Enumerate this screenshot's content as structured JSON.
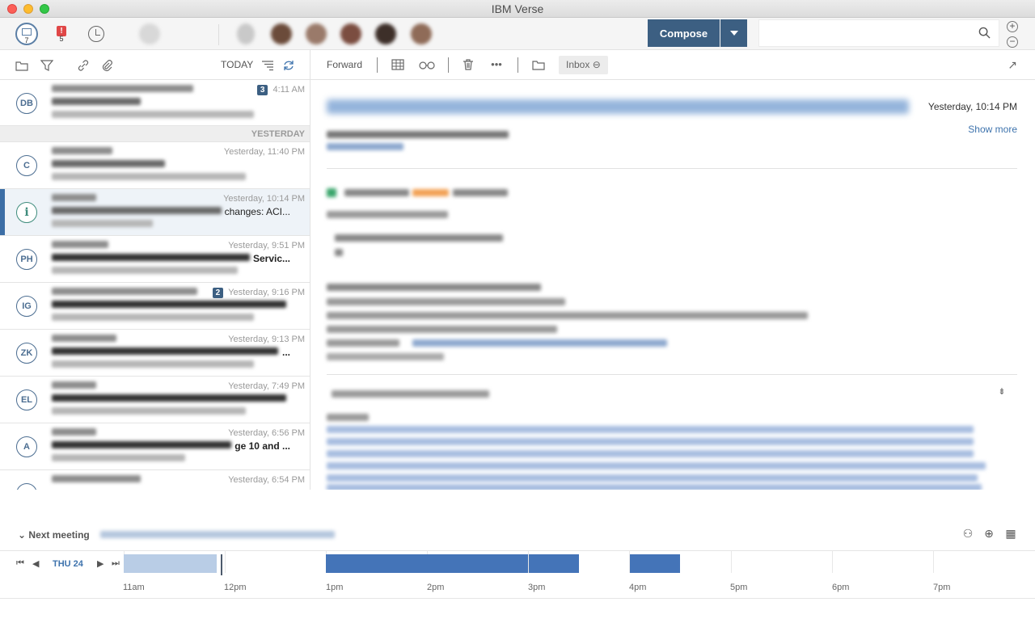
{
  "window": {
    "title": "IBM Verse"
  },
  "topbar": {
    "mail_count": "7",
    "alert_count": "5",
    "alert_glyph": "!",
    "compose_label": "Compose",
    "search": {
      "value": "",
      "placeholder": ""
    }
  },
  "list_toolbar": {
    "today_label": "TODAY"
  },
  "mail_list": {
    "yesterday_header": "YESTERDAY",
    "rows": [
      {
        "initials": "DB",
        "time": "4:11 AM",
        "thread_count": "3",
        "subject_tail": ""
      },
      {
        "initials": "C",
        "time": "Yesterday, 11:40 PM",
        "thread_count": "",
        "subject_tail": ""
      },
      {
        "initials": "i",
        "time": "Yesterday, 10:14 PM",
        "thread_count": "",
        "subject_tail": "changes: ACI..."
      },
      {
        "initials": "PH",
        "time": "Yesterday, 9:51 PM",
        "thread_count": "",
        "subject_tail": "Servic..."
      },
      {
        "initials": "IG",
        "time": "Yesterday, 9:16 PM",
        "thread_count": "2",
        "subject_tail": ""
      },
      {
        "initials": "ZK",
        "time": "Yesterday, 9:13 PM",
        "thread_count": "",
        "subject_tail": "..."
      },
      {
        "initials": "EL",
        "time": "Yesterday, 7:49 PM",
        "thread_count": "",
        "subject_tail": ""
      },
      {
        "initials": "A",
        "time": "Yesterday, 6:56 PM",
        "thread_count": "",
        "subject_tail": "ge 10 and ..."
      },
      {
        "initials": "",
        "time": "Yesterday, 6:54 PM",
        "thread_count": "",
        "subject_tail": ""
      }
    ]
  },
  "reader_toolbar": {
    "forward_label": "Forward",
    "inbox_label": "Inbox"
  },
  "reader": {
    "date": "Yesterday, 10:14 PM",
    "show_more": "Show more"
  },
  "next_meeting": {
    "label": "Next meeting"
  },
  "timeline": {
    "day_label": "THU 24",
    "hours": [
      "11am",
      "12pm",
      "1pm",
      "2pm",
      "3pm",
      "4pm",
      "5pm",
      "6pm",
      "7pm"
    ]
  },
  "colors": {
    "accent": "#3c5f82",
    "link": "#3e73ad",
    "meeting_block": "#4474b8"
  }
}
